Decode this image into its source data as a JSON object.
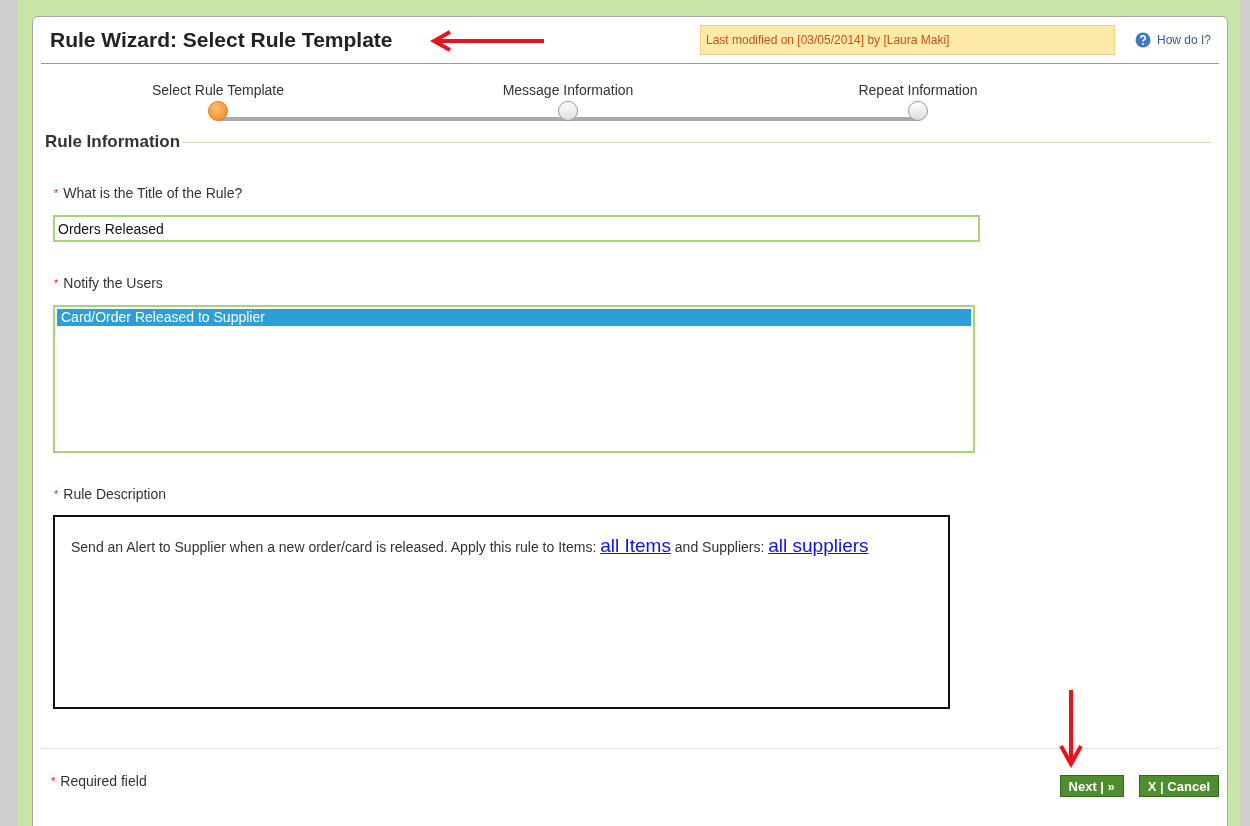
{
  "header": {
    "title": "Rule Wizard: Select Rule Template",
    "modified": "Last modified on [03/05/2014] by [Laura Maki]",
    "help": "How do I?"
  },
  "steps": [
    {
      "label": "Select Rule Template",
      "selected": true
    },
    {
      "label": "Message Information",
      "selected": false
    },
    {
      "label": "Repeat Information",
      "selected": false
    }
  ],
  "section": "Rule Information",
  "fields": [
    {
      "kind": "text",
      "required_mark": "*",
      "label": "What is the Title of the Rule?",
      "value": "Orders Released"
    },
    {
      "kind": "list",
      "required_mark": "*",
      "label": "Notify the Users",
      "options": [
        {
          "label": "Card/Order Released to Supplier",
          "selected": true
        }
      ]
    },
    {
      "kind": "description",
      "required_mark": "*",
      "label": "Rule Description",
      "parts": [
        {
          "kind": "text",
          "text": "Send an Alert to Supplier when a new order/card is released. Apply this rule to Items: "
        },
        {
          "kind": "link",
          "text": "all Items"
        },
        {
          "kind": "text",
          "text": " and Suppliers: "
        },
        {
          "kind": "link",
          "text": "all suppliers"
        }
      ]
    }
  ],
  "footer": {
    "required_mark": "*",
    "required_note": "Required field",
    "buttons": [
      "Next | »",
      "X | Cancel"
    ]
  }
}
